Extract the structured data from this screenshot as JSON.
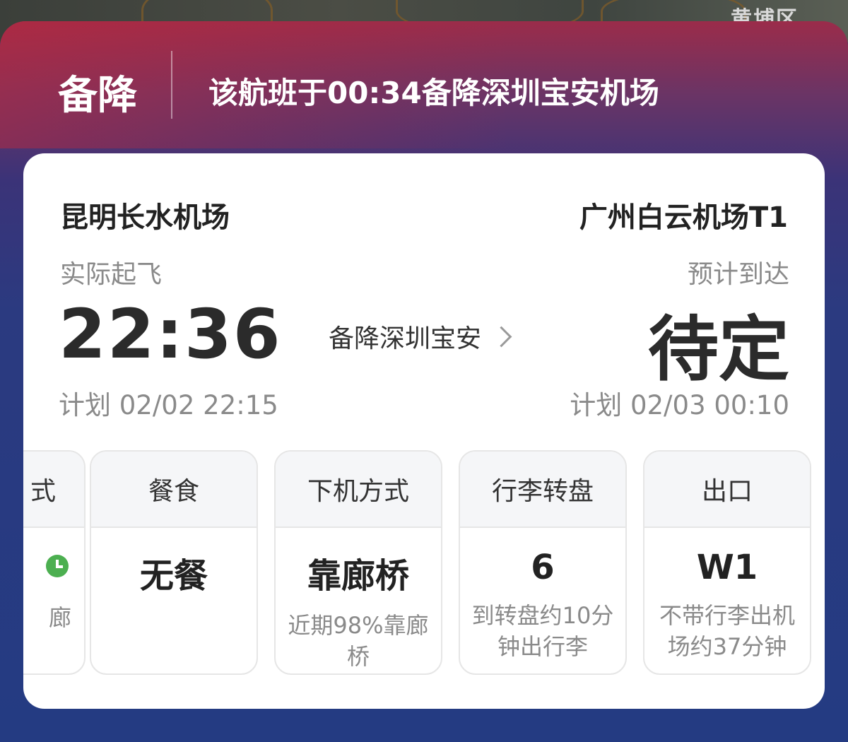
{
  "map": {
    "district_label": "黄埔区"
  },
  "status": {
    "label": "备降",
    "message": "该航班于00:34备降深圳宝安机场"
  },
  "flight": {
    "departure": {
      "airport": "昆明长水机场",
      "time_label": "实际起飞",
      "time": "22:36",
      "plan": "计划 02/02 22:15"
    },
    "arrival": {
      "airport": "广州白云机场T1",
      "time_label": "预计到达",
      "time": "待定",
      "plan": "计划 02/03 00:10"
    },
    "diversion_link": "备降深圳宝安"
  },
  "tiles": {
    "partial": {
      "head": "式",
      "note": "廊"
    },
    "items": [
      {
        "head": "餐食",
        "value": "无餐",
        "note": ""
      },
      {
        "head": "下机方式",
        "value": "靠廊桥",
        "note": "近期98%靠廊桥"
      },
      {
        "head": "行李转盘",
        "value": "6",
        "note": "到转盘约10分钟出行李"
      },
      {
        "head": "出口",
        "value": "W1",
        "note": "不带行李出机场约37分钟"
      }
    ]
  },
  "colors": {
    "header_gradient_top": "#9b2c4a",
    "header_gradient_bottom": "#243b82",
    "clock_green": "#4caf50"
  }
}
